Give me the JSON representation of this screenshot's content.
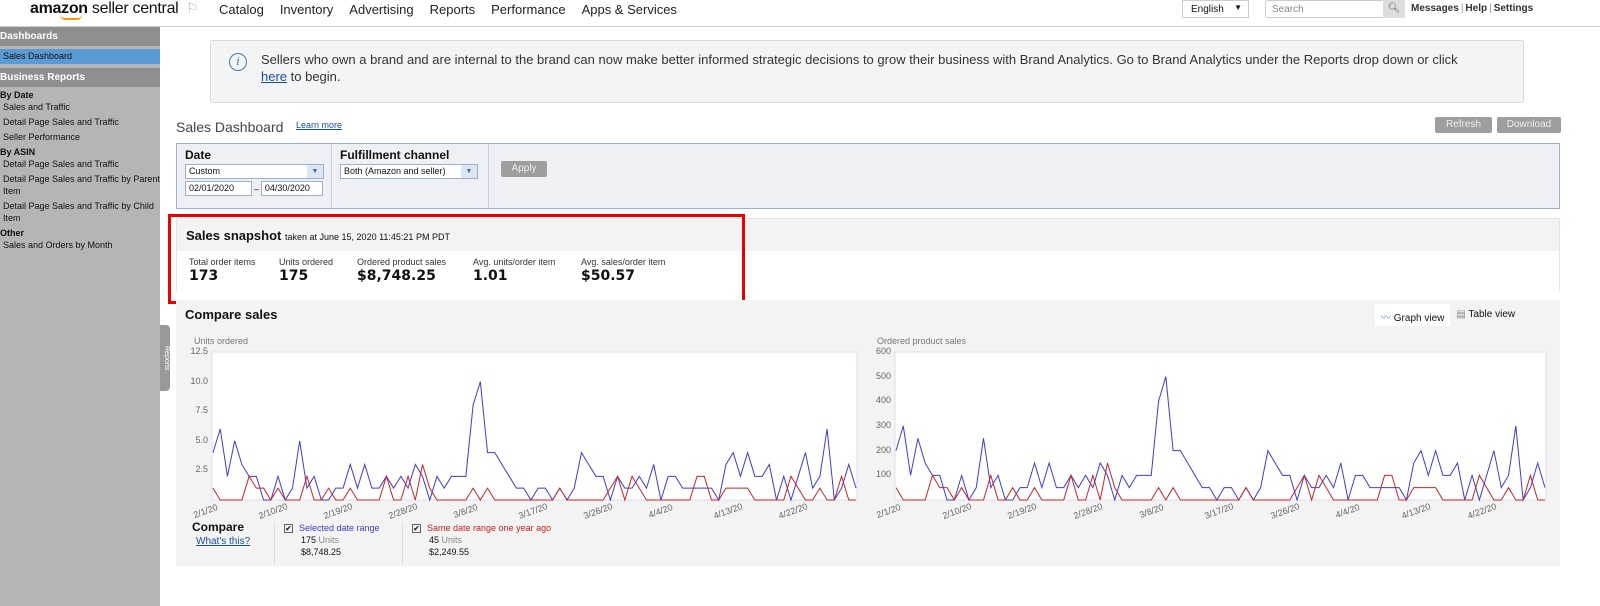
{
  "header": {
    "logo": "amazon seller central",
    "nav": [
      "Catalog",
      "Inventory",
      "Advertising",
      "Reports",
      "Performance",
      "Apps & Services"
    ],
    "language": "English",
    "search_placeholder": "Search",
    "links": [
      "Messages",
      "Help",
      "Settings"
    ]
  },
  "sidebar": {
    "sections": [
      {
        "title": "Dashboards",
        "items": [
          {
            "label": "Sales Dashboard",
            "selected": true
          }
        ]
      },
      {
        "title": "Business Reports",
        "groups": [
          {
            "label": "By Date",
            "items": [
              "Sales and Traffic",
              "Detail Page Sales and Traffic",
              "Seller Performance"
            ]
          },
          {
            "label": "By ASIN",
            "items": [
              "Detail Page Sales and Traffic",
              "Detail Page Sales and Traffic by Parent Item",
              "Detail Page Sales and Traffic by Child Item"
            ]
          },
          {
            "label": "Other",
            "items": [
              "Sales and Orders by Month"
            ]
          }
        ]
      }
    ],
    "handle": "Reports"
  },
  "info": {
    "text": "Sellers who own a brand and are internal to the brand can now make better informed strategic decisions to grow their business with Brand Analytics. Go to Brand Analytics under the Reports drop down or click ",
    "link": "here",
    "tail": " to begin."
  },
  "page": {
    "title": "Sales Dashboard",
    "learn_more": "Learn more",
    "refresh": "Refresh",
    "download": "Download"
  },
  "filters": {
    "date_label": "Date",
    "date_value": "Custom",
    "from": "02/01/2020",
    "to": "04/30/2020",
    "sep": "–",
    "channel_label": "Fulfillment channel",
    "channel_value": "Both (Amazon and seller)",
    "apply": "Apply"
  },
  "snapshot": {
    "title": "Sales snapshot",
    "taken": "taken at June 15, 2020 11:45:21 PM PDT",
    "metrics": [
      {
        "label": "Total order items",
        "value": "173"
      },
      {
        "label": "Units ordered",
        "value": "175"
      },
      {
        "label": "Ordered product sales",
        "value": "$8,748.25"
      },
      {
        "label": "Avg. units/order item",
        "value": "1.01"
      },
      {
        "label": "Avg. sales/order item",
        "value": "$50.57"
      }
    ],
    "highlight_color": "#e00000"
  },
  "compare": {
    "title": "Compare sales",
    "graph_view": "Graph view",
    "table_view": "Table view",
    "compare_label": "Compare",
    "whats_this": "What's this?",
    "legend": [
      {
        "name": "Selected date range",
        "units": "175",
        "units_label": "Units",
        "sales": "$8,748.25",
        "color": "#3b3bdc",
        "checked": true
      },
      {
        "name": "Same date range one year ago",
        "units": "45",
        "units_label": "Units",
        "sales": "$2,249.55",
        "color": "#cc2222",
        "checked": true
      }
    ]
  },
  "chart_data": [
    {
      "type": "line",
      "title": "Units ordered",
      "x_range": [
        "2020-02-01",
        "2020-04-30"
      ],
      "x_ticks": [
        "2/1/20",
        "2/10/20",
        "2/19/20",
        "2/28/20",
        "3/8/20",
        "3/17/20",
        "3/26/20",
        "4/4/20",
        "4/13/20",
        "4/22/20"
      ],
      "y_ticks": [
        "2.5",
        "5.0",
        "7.5",
        "10.0",
        "12.5"
      ],
      "ylim": [
        0,
        12.5
      ],
      "series": [
        {
          "name": "Selected date range",
          "color": "#3b3bdc",
          "values": [
            4,
            6,
            2,
            5,
            3,
            2,
            2,
            0,
            0,
            2,
            0,
            1,
            5,
            1,
            2,
            0,
            0,
            1,
            1,
            3,
            1,
            3,
            1,
            1,
            2,
            1,
            2,
            1,
            3,
            2,
            0,
            2,
            1,
            2,
            2,
            2,
            8,
            10,
            4,
            4,
            3,
            2,
            1,
            1,
            0,
            1,
            1,
            0,
            1,
            0,
            1,
            4,
            3,
            2,
            2,
            0,
            2,
            1,
            1,
            2,
            1,
            3,
            0,
            2,
            2,
            1,
            1,
            1,
            1,
            1,
            0,
            3,
            4,
            2,
            4,
            2,
            2,
            3,
            0,
            2,
            0,
            2,
            4,
            1,
            2,
            6,
            0,
            1,
            3,
            1
          ]
        },
        {
          "name": "Same date range one year ago",
          "color": "#cc2222",
          "values": [
            1,
            0,
            0,
            0,
            0,
            2,
            1,
            1,
            0,
            1,
            0,
            0,
            0,
            2,
            0,
            0,
            1,
            0,
            0,
            1,
            0,
            0,
            0,
            0,
            2,
            0,
            0,
            2,
            0,
            3,
            1,
            0,
            0,
            0,
            0,
            0,
            1,
            0,
            1,
            0,
            0,
            0,
            0,
            0,
            0,
            0,
            0,
            0,
            1,
            0,
            0,
            0,
            0,
            0,
            0,
            1,
            2,
            0,
            2,
            1,
            0,
            0,
            0,
            0,
            0,
            0,
            0,
            2,
            2,
            0,
            0,
            1,
            1,
            1,
            1,
            0,
            0,
            0,
            0,
            0,
            2,
            1,
            0,
            0,
            1,
            0,
            0,
            2,
            0,
            0
          ]
        }
      ]
    },
    {
      "type": "line",
      "title": "Ordered product sales",
      "x_range": [
        "2020-02-01",
        "2020-04-30"
      ],
      "x_ticks": [
        "2/1/20",
        "2/10/20",
        "2/19/20",
        "2/28/20",
        "3/8/20",
        "3/17/20",
        "3/26/20",
        "4/4/20",
        "4/13/20",
        "4/22/20"
      ],
      "y_ticks": [
        "100",
        "200",
        "300",
        "400",
        "500",
        "600"
      ],
      "ylim": [
        0,
        600
      ],
      "series": [
        {
          "name": "Selected date range",
          "color": "#3b3bdc",
          "values": [
            200,
            300,
            100,
            250,
            150,
            100,
            100,
            0,
            0,
            100,
            0,
            50,
            250,
            50,
            100,
            0,
            0,
            50,
            50,
            150,
            50,
            150,
            50,
            50,
            100,
            50,
            100,
            50,
            150,
            100,
            0,
            100,
            50,
            100,
            100,
            100,
            400,
            500,
            200,
            200,
            150,
            100,
            50,
            50,
            0,
            50,
            50,
            0,
            50,
            0,
            50,
            200,
            150,
            100,
            100,
            0,
            100,
            50,
            50,
            100,
            50,
            150,
            0,
            100,
            100,
            50,
            50,
            50,
            50,
            50,
            0,
            150,
            200,
            100,
            200,
            100,
            100,
            150,
            0,
            100,
            0,
            100,
            200,
            50,
            100,
            300,
            0,
            50,
            150,
            50
          ]
        },
        {
          "name": "Same date range one year ago",
          "color": "#cc2222",
          "values": [
            50,
            0,
            0,
            0,
            0,
            100,
            50,
            50,
            0,
            50,
            0,
            0,
            0,
            100,
            0,
            0,
            50,
            0,
            0,
            50,
            0,
            0,
            0,
            0,
            100,
            0,
            0,
            100,
            0,
            150,
            50,
            0,
            0,
            0,
            0,
            0,
            50,
            0,
            50,
            0,
            0,
            0,
            0,
            0,
            0,
            0,
            0,
            0,
            50,
            0,
            0,
            0,
            0,
            0,
            0,
            50,
            100,
            0,
            100,
            50,
            0,
            0,
            0,
            0,
            0,
            0,
            0,
            100,
            100,
            0,
            0,
            50,
            50,
            50,
            50,
            0,
            0,
            0,
            0,
            0,
            100,
            50,
            0,
            0,
            50,
            0,
            0,
            100,
            0,
            0
          ]
        }
      ]
    }
  ]
}
